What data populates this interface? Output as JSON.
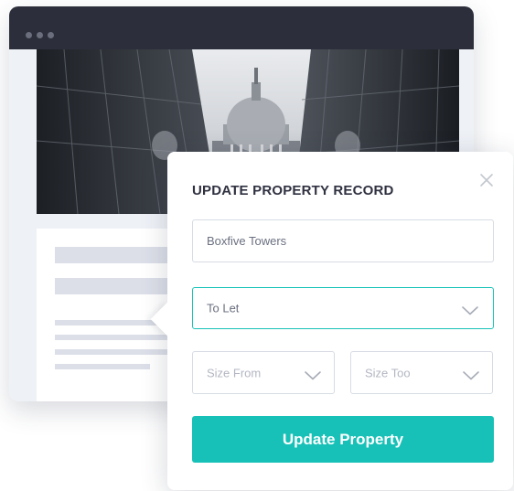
{
  "modal": {
    "title": "UPDATE PROPERTY RECORD",
    "close_icon": "close-icon",
    "property_name": {
      "value": "Boxfive Towers"
    },
    "status_select": {
      "selected": "To Let",
      "icon": "chevron-down-icon"
    },
    "size_from_select": {
      "placeholder": "Size From",
      "icon": "chevron-down-icon"
    },
    "size_to_select": {
      "placeholder": "Size Too",
      "icon": "chevron-down-icon"
    },
    "submit_label": "Update Property"
  },
  "colors": {
    "accent": "#17c1b7",
    "titlebar": "#2c2f3b",
    "placeholder_gray": "#dcdfe8",
    "window_bg": "#eef1f6"
  },
  "browser": {
    "hero_image": "building-reflection-photo"
  }
}
